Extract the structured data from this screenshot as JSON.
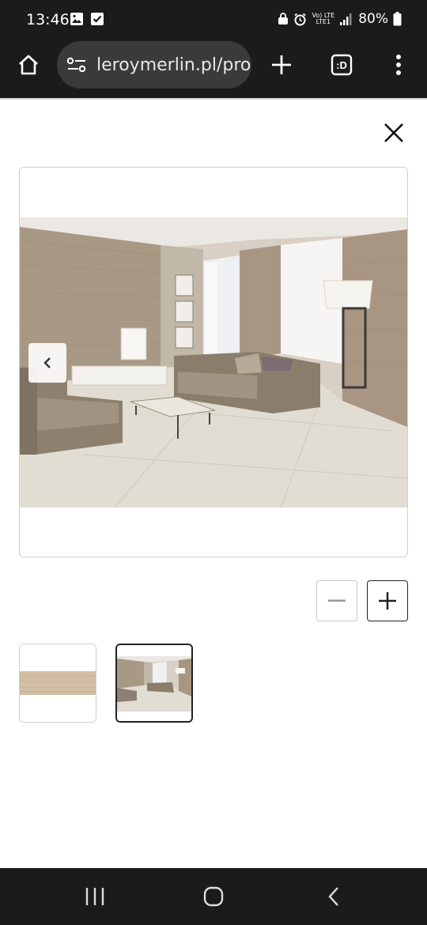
{
  "status_bar": {
    "time": "13:46",
    "battery": "80%",
    "lte_top": "Vo) LTE",
    "lte_bottom": "LTE1"
  },
  "browser": {
    "url": "leroymerlin.pl/pro",
    "tab_count": ":D",
    "icons": [
      "home-icon",
      "site-settings-icon",
      "new-tab-plus-icon",
      "tab-switcher-icon",
      "more-vert-icon"
    ]
  },
  "gallery": {
    "current_index": 2,
    "total": 2,
    "thumbnails": [
      {
        "name": "wood-plank-tile",
        "selected": false
      },
      {
        "name": "living-room-scene",
        "selected": true
      }
    ]
  },
  "colors": {
    "bar_bg": "#1b1b1b",
    "pill_bg": "#3a3a3a",
    "border": "#cfcfcf",
    "selected_border": "#222222"
  }
}
